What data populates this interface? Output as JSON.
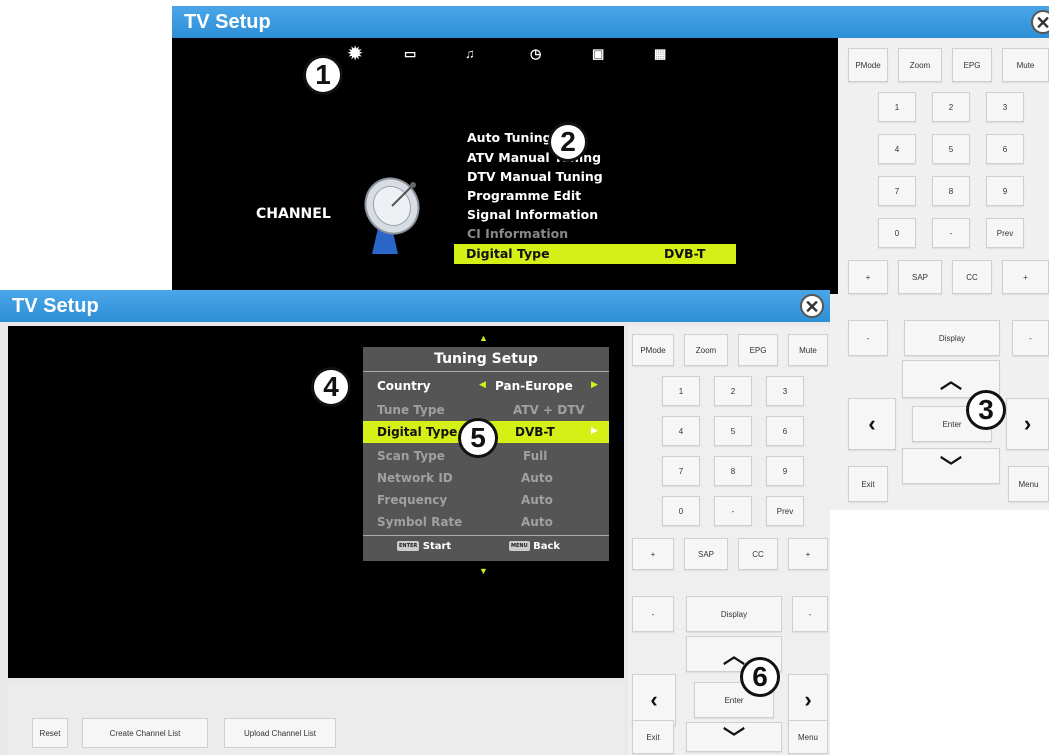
{
  "back_window": {
    "title": "TV Setup",
    "close_symbol": "✕",
    "tabs": [
      "gear-icon",
      "picture-icon",
      "music-note-icon",
      "clock-icon",
      "lock-icon",
      "grid-icon"
    ],
    "section_label": "CHANNEL",
    "menu_items": [
      "Auto Tuning",
      "ATV Manual Tuning",
      "DTV Manual Tuning",
      "Programme Edit",
      "Signal Information",
      "CI Information"
    ],
    "selected_item": {
      "label": "Digital Type",
      "value": "DVB-T"
    },
    "remote": {
      "top_row": [
        "PMode",
        "Zoom",
        "EPG",
        "Mute"
      ],
      "digits": [
        "1",
        "2",
        "3",
        "4",
        "5",
        "6",
        "7",
        "8",
        "9",
        "0",
        "-",
        "Prev"
      ],
      "row_sap": [
        "+",
        "SAP",
        "CC",
        "+"
      ],
      "row_display": [
        "-",
        "Display",
        "-"
      ],
      "enter_label": "Enter",
      "exit_label": "Exit",
      "menu_label": "Menu"
    }
  },
  "front_window": {
    "title": "TV Setup",
    "close_symbol": "✕",
    "tuning_setup": {
      "title": "Tuning Setup",
      "rows": [
        {
          "label": "Country",
          "value": "Pan-Europe"
        },
        {
          "label": "Tune Type",
          "value": "ATV + DTV"
        },
        {
          "label": "Digital Type",
          "value": "DVB-T"
        },
        {
          "label": "Scan Type",
          "value": "Full"
        },
        {
          "label": "Network ID",
          "value": "Auto"
        },
        {
          "label": "Frequency",
          "value": "Auto"
        },
        {
          "label": "Symbol Rate",
          "value": "Auto"
        }
      ],
      "start_key": "ENTER",
      "start_label": "Start",
      "back_key": "MENU",
      "back_label": "Back"
    },
    "remote": {
      "top_row": [
        "PMode",
        "Zoom",
        "EPG",
        "Mute"
      ],
      "digits": [
        "1",
        "2",
        "3",
        "4",
        "5",
        "6",
        "7",
        "8",
        "9",
        "0",
        "-",
        "Prev"
      ],
      "row_sap": [
        "+",
        "SAP",
        "CC",
        "+"
      ],
      "row_display": [
        "-",
        "Display",
        "-"
      ],
      "enter_label": "Enter",
      "exit_label": "Exit",
      "menu_label": "Menu"
    },
    "bottom_buttons": [
      "Reset",
      "Create Channel List",
      "Upload Channel List"
    ]
  },
  "callouts": [
    "1",
    "2",
    "3",
    "4",
    "5",
    "6"
  ],
  "colors": {
    "titlebar": "#2e8fd6",
    "highlight": "#d4f016",
    "screen": "#000000"
  }
}
